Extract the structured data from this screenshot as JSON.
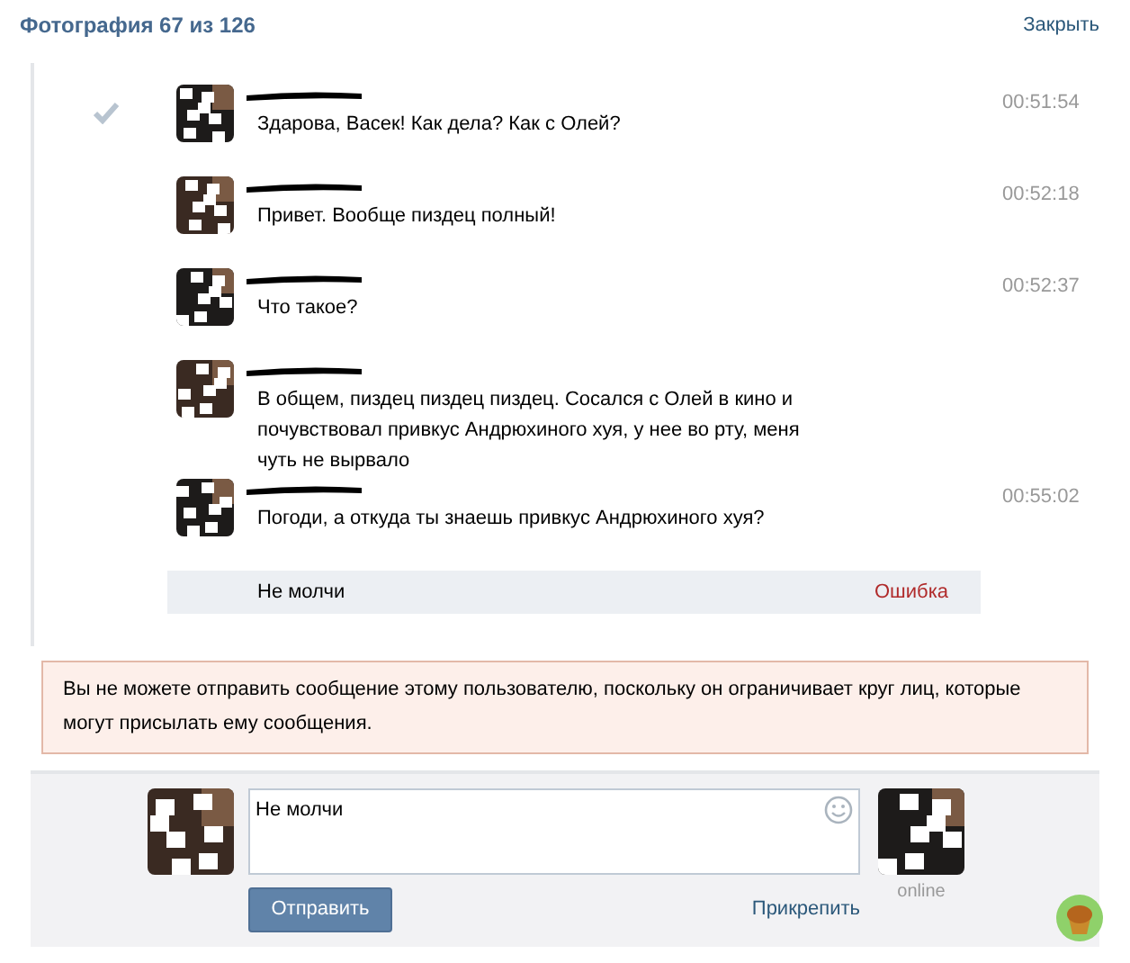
{
  "header": {
    "title": "Фотография 67 из 126",
    "close": "Закрыть"
  },
  "messages": [
    {
      "checked": true,
      "time": "00:51:54",
      "text": "Здарова, Васек! Как дела? Как с Олей?"
    },
    {
      "checked": false,
      "time": "00:52:18",
      "text": "Привет. Вообще пиздец полный!"
    },
    {
      "checked": false,
      "time": "00:52:37",
      "text": "Что такое?"
    },
    {
      "checked": false,
      "text": "В общем, пиздец пиздец пиздец. Сосался с Олей в кино и почувствовал привкус Андрюхиного хуя, у нее во рту, меня чуть не вырвало"
    },
    {
      "checked": false,
      "time": "00:55:02",
      "text": "Погоди, а откуда ты знаешь привкус Андрюхиного хуя?"
    }
  ],
  "failed_message": {
    "text": "Не молчи",
    "status": "Ошибка"
  },
  "error_notice": "Вы не можете отправить сообщение этому пользователю, поскольку он ограничивает круг лиц, которые могут присылать ему сообщения.",
  "composer": {
    "value": "Не молчи",
    "send": "Отправить",
    "attach": "Прикрепить",
    "peer_status": "online"
  }
}
